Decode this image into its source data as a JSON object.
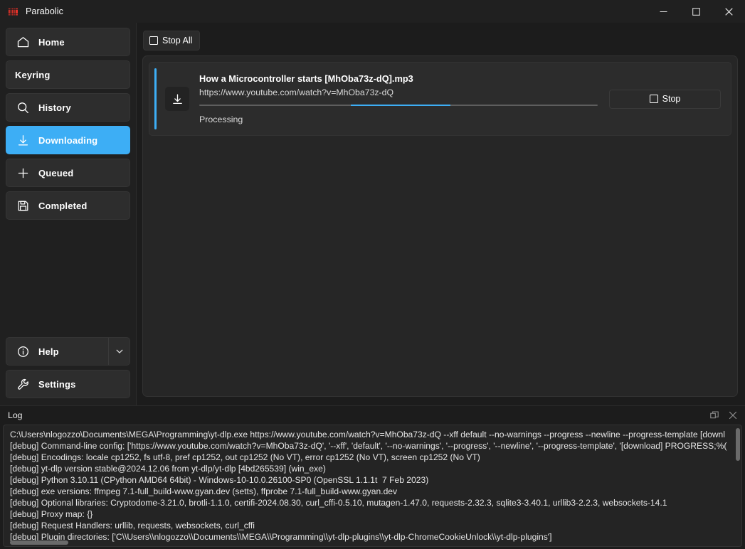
{
  "window": {
    "title": "Parabolic",
    "app_icon": "parabolic-logo-icon",
    "controls": {
      "minimize": "minimize-icon",
      "maximize": "maximize-icon",
      "close": "close-icon"
    }
  },
  "accent_color": "#3daef5",
  "sidebar": {
    "items": [
      {
        "label": "Home",
        "icon": "home-icon",
        "active": false
      },
      {
        "label": "Keyring",
        "icon": "none",
        "active": false
      },
      {
        "label": "History",
        "icon": "search-icon",
        "active": false
      },
      {
        "label": "Downloading",
        "icon": "download-arrow-icon",
        "active": true
      },
      {
        "label": "Queued",
        "icon": "plus-icon",
        "active": false
      },
      {
        "label": "Completed",
        "icon": "save-disk-icon",
        "active": false
      }
    ],
    "bottom_items": [
      {
        "label": "Help",
        "icon": "info-circle-icon",
        "has_dropdown": true,
        "dropdown_icon": "chevron-down-icon"
      },
      {
        "label": "Settings",
        "icon": "wrench-icon",
        "has_dropdown": false
      }
    ]
  },
  "toolbar": {
    "stop_all_label": "Stop All",
    "stop_all_icon": "stop-square-icon"
  },
  "downloads": [
    {
      "icon": "download-arrow-icon",
      "title": "How a Microcontroller starts [MhOba73z-dQ].mp3",
      "url": "https://www.youtube.com/watch?v=MhOba73z-dQ",
      "status": "Processing",
      "progress_indeterminate": true,
      "progress_segment_left_pct": 38,
      "progress_segment_width_pct": 25,
      "action_label": "Stop",
      "action_icon": "stop-square-icon"
    }
  ],
  "log": {
    "title": "Log",
    "header_buttons": [
      {
        "icon": "undock-icon"
      },
      {
        "icon": "close-icon"
      }
    ],
    "lines": [
      "C:\\Users\\nlogozzo\\Documents\\MEGA\\Programming\\yt-dlp.exe https://www.youtube.com/watch?v=MhOba73z-dQ --xff default --no-warnings --progress --newline --progress-template [downl",
      "[debug] Command-line config: ['https://www.youtube.com/watch?v=MhOba73z-dQ', '--xff', 'default', '--no-warnings', '--progress', '--newline', '--progress-template', '[download] PROGRESS;%(",
      "[debug] Encodings: locale cp1252, fs utf-8, pref cp1252, out cp1252 (No VT), error cp1252 (No VT), screen cp1252 (No VT)",
      "[debug] yt-dlp version stable@2024.12.06 from yt-dlp/yt-dlp [4bd265539] (win_exe)",
      "[debug] Python 3.10.11 (CPython AMD64 64bit) - Windows-10-10.0.26100-SP0 (OpenSSL 1.1.1t  7 Feb 2023)",
      "[debug] exe versions: ffmpeg 7.1-full_build-www.gyan.dev (setts), ffprobe 7.1-full_build-www.gyan.dev",
      "[debug] Optional libraries: Cryptodome-3.21.0, brotli-1.1.0, certifi-2024.08.30, curl_cffi-0.5.10, mutagen-1.47.0, requests-2.32.3, sqlite3-3.40.1, urllib3-2.2.3, websockets-14.1",
      "[debug] Proxy map: {}",
      "[debug] Request Handlers: urllib, requests, websockets, curl_cffi",
      "[debug] Plugin directories: ['C\\\\Users\\\\nlogozzo\\\\Documents\\\\MEGA\\\\Programming\\\\yt-dlp-plugins\\\\yt-dlp-ChromeCookieUnlock\\\\yt-dlp-plugins']"
    ]
  }
}
